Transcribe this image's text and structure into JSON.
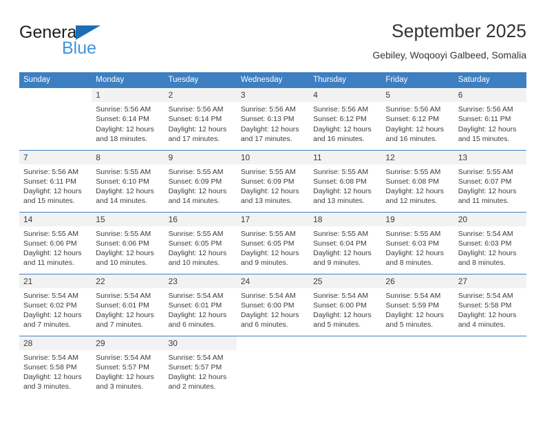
{
  "brand": {
    "general_text": "General",
    "blue_text": "Blue",
    "flag_icon": "triangle-flag-icon",
    "primary_color": "#1f6db5",
    "accent_color": "#3f94dd"
  },
  "header": {
    "title": "September 2025",
    "subtitle": "Gebiley, Woqooyi Galbeed, Somalia"
  },
  "theme": {
    "header_row_bg": "#3d7fc1",
    "daynum_bg": "#f2f2f2",
    "text_color": "#3b3b3b",
    "row_divider": "#3d7fc1"
  },
  "weekdays": [
    "Sunday",
    "Monday",
    "Tuesday",
    "Wednesday",
    "Thursday",
    "Friday",
    "Saturday"
  ],
  "weeks": [
    [
      {
        "day": "",
        "sunrise": "",
        "sunset": "",
        "daylight1": "",
        "daylight2": ""
      },
      {
        "day": "1",
        "sunrise": "Sunrise: 5:56 AM",
        "sunset": "Sunset: 6:14 PM",
        "daylight1": "Daylight: 12 hours",
        "daylight2": "and 18 minutes."
      },
      {
        "day": "2",
        "sunrise": "Sunrise: 5:56 AM",
        "sunset": "Sunset: 6:14 PM",
        "daylight1": "Daylight: 12 hours",
        "daylight2": "and 17 minutes."
      },
      {
        "day": "3",
        "sunrise": "Sunrise: 5:56 AM",
        "sunset": "Sunset: 6:13 PM",
        "daylight1": "Daylight: 12 hours",
        "daylight2": "and 17 minutes."
      },
      {
        "day": "4",
        "sunrise": "Sunrise: 5:56 AM",
        "sunset": "Sunset: 6:12 PM",
        "daylight1": "Daylight: 12 hours",
        "daylight2": "and 16 minutes."
      },
      {
        "day": "5",
        "sunrise": "Sunrise: 5:56 AM",
        "sunset": "Sunset: 6:12 PM",
        "daylight1": "Daylight: 12 hours",
        "daylight2": "and 16 minutes."
      },
      {
        "day": "6",
        "sunrise": "Sunrise: 5:56 AM",
        "sunset": "Sunset: 6:11 PM",
        "daylight1": "Daylight: 12 hours",
        "daylight2": "and 15 minutes."
      }
    ],
    [
      {
        "day": "7",
        "sunrise": "Sunrise: 5:56 AM",
        "sunset": "Sunset: 6:11 PM",
        "daylight1": "Daylight: 12 hours",
        "daylight2": "and 15 minutes."
      },
      {
        "day": "8",
        "sunrise": "Sunrise: 5:55 AM",
        "sunset": "Sunset: 6:10 PM",
        "daylight1": "Daylight: 12 hours",
        "daylight2": "and 14 minutes."
      },
      {
        "day": "9",
        "sunrise": "Sunrise: 5:55 AM",
        "sunset": "Sunset: 6:09 PM",
        "daylight1": "Daylight: 12 hours",
        "daylight2": "and 14 minutes."
      },
      {
        "day": "10",
        "sunrise": "Sunrise: 5:55 AM",
        "sunset": "Sunset: 6:09 PM",
        "daylight1": "Daylight: 12 hours",
        "daylight2": "and 13 minutes."
      },
      {
        "day": "11",
        "sunrise": "Sunrise: 5:55 AM",
        "sunset": "Sunset: 6:08 PM",
        "daylight1": "Daylight: 12 hours",
        "daylight2": "and 13 minutes."
      },
      {
        "day": "12",
        "sunrise": "Sunrise: 5:55 AM",
        "sunset": "Sunset: 6:08 PM",
        "daylight1": "Daylight: 12 hours",
        "daylight2": "and 12 minutes."
      },
      {
        "day": "13",
        "sunrise": "Sunrise: 5:55 AM",
        "sunset": "Sunset: 6:07 PM",
        "daylight1": "Daylight: 12 hours",
        "daylight2": "and 11 minutes."
      }
    ],
    [
      {
        "day": "14",
        "sunrise": "Sunrise: 5:55 AM",
        "sunset": "Sunset: 6:06 PM",
        "daylight1": "Daylight: 12 hours",
        "daylight2": "and 11 minutes."
      },
      {
        "day": "15",
        "sunrise": "Sunrise: 5:55 AM",
        "sunset": "Sunset: 6:06 PM",
        "daylight1": "Daylight: 12 hours",
        "daylight2": "and 10 minutes."
      },
      {
        "day": "16",
        "sunrise": "Sunrise: 5:55 AM",
        "sunset": "Sunset: 6:05 PM",
        "daylight1": "Daylight: 12 hours",
        "daylight2": "and 10 minutes."
      },
      {
        "day": "17",
        "sunrise": "Sunrise: 5:55 AM",
        "sunset": "Sunset: 6:05 PM",
        "daylight1": "Daylight: 12 hours",
        "daylight2": "and 9 minutes."
      },
      {
        "day": "18",
        "sunrise": "Sunrise: 5:55 AM",
        "sunset": "Sunset: 6:04 PM",
        "daylight1": "Daylight: 12 hours",
        "daylight2": "and 9 minutes."
      },
      {
        "day": "19",
        "sunrise": "Sunrise: 5:55 AM",
        "sunset": "Sunset: 6:03 PM",
        "daylight1": "Daylight: 12 hours",
        "daylight2": "and 8 minutes."
      },
      {
        "day": "20",
        "sunrise": "Sunrise: 5:54 AM",
        "sunset": "Sunset: 6:03 PM",
        "daylight1": "Daylight: 12 hours",
        "daylight2": "and 8 minutes."
      }
    ],
    [
      {
        "day": "21",
        "sunrise": "Sunrise: 5:54 AM",
        "sunset": "Sunset: 6:02 PM",
        "daylight1": "Daylight: 12 hours",
        "daylight2": "and 7 minutes."
      },
      {
        "day": "22",
        "sunrise": "Sunrise: 5:54 AM",
        "sunset": "Sunset: 6:01 PM",
        "daylight1": "Daylight: 12 hours",
        "daylight2": "and 7 minutes."
      },
      {
        "day": "23",
        "sunrise": "Sunrise: 5:54 AM",
        "sunset": "Sunset: 6:01 PM",
        "daylight1": "Daylight: 12 hours",
        "daylight2": "and 6 minutes."
      },
      {
        "day": "24",
        "sunrise": "Sunrise: 5:54 AM",
        "sunset": "Sunset: 6:00 PM",
        "daylight1": "Daylight: 12 hours",
        "daylight2": "and 6 minutes."
      },
      {
        "day": "25",
        "sunrise": "Sunrise: 5:54 AM",
        "sunset": "Sunset: 6:00 PM",
        "daylight1": "Daylight: 12 hours",
        "daylight2": "and 5 minutes."
      },
      {
        "day": "26",
        "sunrise": "Sunrise: 5:54 AM",
        "sunset": "Sunset: 5:59 PM",
        "daylight1": "Daylight: 12 hours",
        "daylight2": "and 5 minutes."
      },
      {
        "day": "27",
        "sunrise": "Sunrise: 5:54 AM",
        "sunset": "Sunset: 5:58 PM",
        "daylight1": "Daylight: 12 hours",
        "daylight2": "and 4 minutes."
      }
    ],
    [
      {
        "day": "28",
        "sunrise": "Sunrise: 5:54 AM",
        "sunset": "Sunset: 5:58 PM",
        "daylight1": "Daylight: 12 hours",
        "daylight2": "and 3 minutes."
      },
      {
        "day": "29",
        "sunrise": "Sunrise: 5:54 AM",
        "sunset": "Sunset: 5:57 PM",
        "daylight1": "Daylight: 12 hours",
        "daylight2": "and 3 minutes."
      },
      {
        "day": "30",
        "sunrise": "Sunrise: 5:54 AM",
        "sunset": "Sunset: 5:57 PM",
        "daylight1": "Daylight: 12 hours",
        "daylight2": "and 2 minutes."
      },
      {
        "day": "",
        "sunrise": "",
        "sunset": "",
        "daylight1": "",
        "daylight2": ""
      },
      {
        "day": "",
        "sunrise": "",
        "sunset": "",
        "daylight1": "",
        "daylight2": ""
      },
      {
        "day": "",
        "sunrise": "",
        "sunset": "",
        "daylight1": "",
        "daylight2": ""
      },
      {
        "day": "",
        "sunrise": "",
        "sunset": "",
        "daylight1": "",
        "daylight2": ""
      }
    ]
  ]
}
